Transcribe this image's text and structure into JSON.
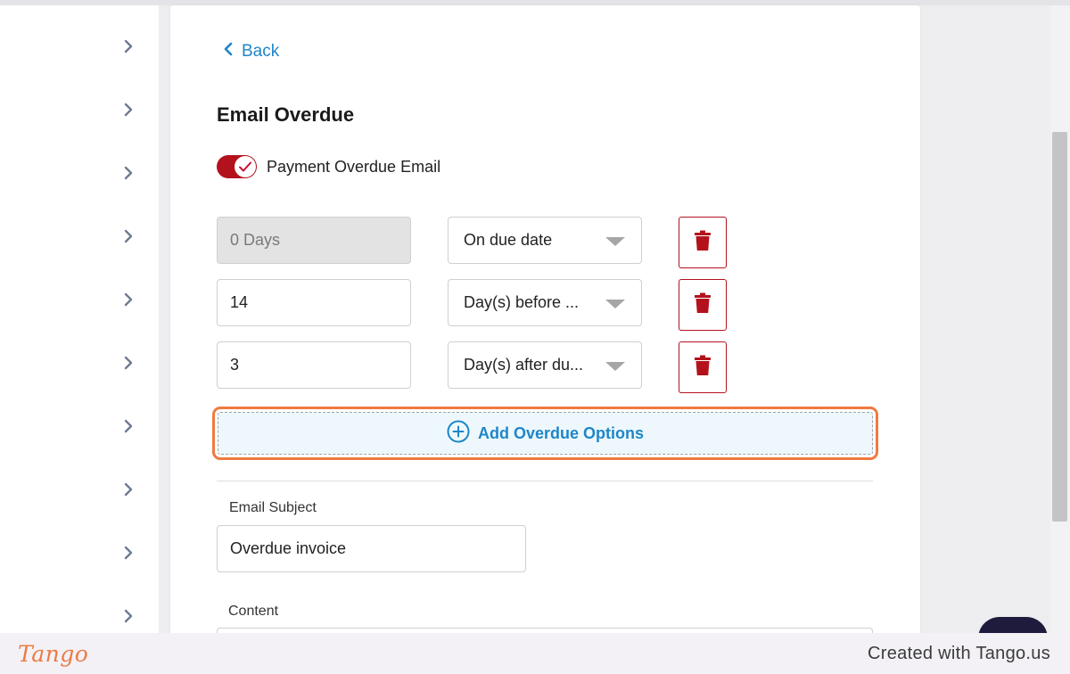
{
  "colors": {
    "accent_blue": "#1e86c8",
    "brand_red": "#b3121d",
    "highlight_orange": "#f07a41",
    "tango_orange": "#ec7b43"
  },
  "sidebar": {
    "chevron_icon": "chevron-right-icon",
    "item_count": 10
  },
  "header": {
    "back_label": "Back"
  },
  "email_overdue": {
    "title": "Email Overdue",
    "toggle_label": "Payment Overdue Email",
    "toggle_on": true,
    "rows": [
      {
        "days_value": "0 Days",
        "days_disabled": true,
        "timing": "On due date"
      },
      {
        "days_value": "14",
        "days_disabled": false,
        "timing": "Day(s) before ..."
      },
      {
        "days_value": "3",
        "days_disabled": false,
        "timing": "Day(s) after du..."
      }
    ],
    "delete_icon": "trash-icon",
    "add_label": "Add Overdue Options",
    "add_icon": "plus-circle-icon"
  },
  "subject": {
    "label": "Email Subject",
    "value": "Overdue invoice"
  },
  "content": {
    "label": "Content"
  },
  "footer": {
    "logo": "Tango",
    "credit": "Created with Tango.us"
  }
}
